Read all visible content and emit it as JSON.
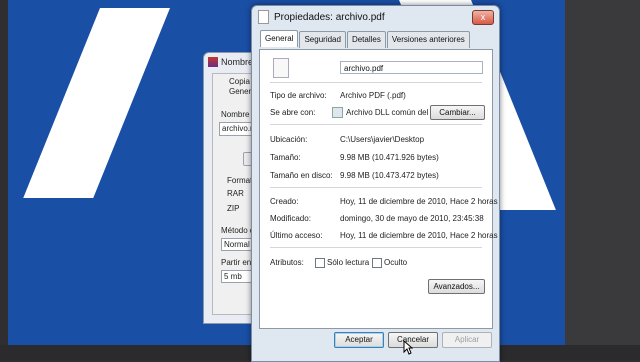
{
  "background_window": {
    "title": "Nombre",
    "tab_label": "Copia",
    "tab_label2": "Genera",
    "name_label": "Nombre d",
    "name_value": "archivo.r",
    "format_label": "Formato",
    "opt_rar": "RAR",
    "opt_zip": "ZIP",
    "method_label": "Método d",
    "method_value": "Normal",
    "split_label": "Partir en",
    "split_value": "5 mb"
  },
  "window": {
    "title": "Propiedades: archivo.pdf",
    "close": "x"
  },
  "tabs": [
    {
      "label": "General"
    },
    {
      "label": "Seguridad"
    },
    {
      "label": "Detalles"
    },
    {
      "label": "Versiones anteriores"
    }
  ],
  "general": {
    "file_name": "archivo.pdf",
    "type_label": "Tipo de archivo:",
    "type_value": "Archivo PDF (.pdf)",
    "opens_label": "Se abre con:",
    "opens_value": "Archivo DLL común del",
    "change_button": "Cambiar...",
    "location_label": "Ubicación:",
    "location_value": "C:\\Users\\javier\\Desktop",
    "size_label": "Tamaño:",
    "size_value": "9.98 MB (10.471.926 bytes)",
    "disk_size_label": "Tamaño en disco:",
    "disk_size_value": "9.98 MB (10.473.472 bytes)",
    "created_label": "Creado:",
    "created_value": "Hoy, 11 de diciembre de 2010, Hace 2 horas",
    "modified_label": "Modificado:",
    "modified_value": "domingo, 30 de mayo de 2010, 23:45:38",
    "accessed_label": "Último acceso:",
    "accessed_value": "Hoy, 11 de diciembre de 2010, Hace 2 horas",
    "attributes_label": "Atributos:",
    "readonly_label": "Sólo lectura",
    "hidden_label": "Oculto",
    "advanced_button": "Avanzados..."
  },
  "footer": {
    "accept": "Aceptar",
    "cancel": "Cancelar",
    "apply": "Aplicar"
  }
}
